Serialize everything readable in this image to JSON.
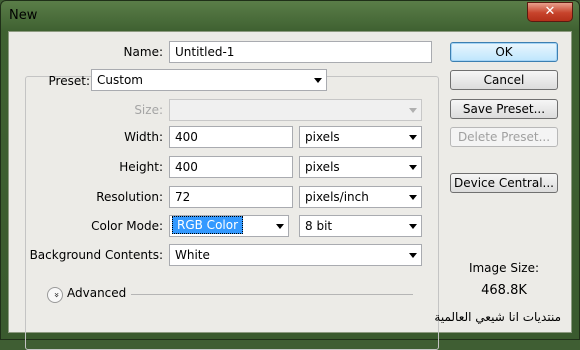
{
  "window": {
    "title": "New",
    "close_glyph": "✕"
  },
  "form": {
    "name_label": "Name:",
    "name_value": "Untitled-1",
    "preset_label": "Preset:",
    "preset_value": "Custom",
    "size_label": "Size:",
    "size_value": "",
    "width_label": "Width:",
    "width_value": "400",
    "width_unit": "pixels",
    "height_label": "Height:",
    "height_value": "400",
    "height_unit": "pixels",
    "resolution_label": "Resolution:",
    "resolution_value": "72",
    "resolution_unit": "pixels/inch",
    "color_mode_label": "Color Mode:",
    "color_mode_value": "RGB Color",
    "bit_depth_value": "8 bit",
    "background_label": "Background Contents:",
    "background_value": "White",
    "advanced_label": "Advanced",
    "advanced_icon": "double-chevron-down-icon",
    "advanced_glyph": "»"
  },
  "buttons": {
    "ok": "OK",
    "cancel": "Cancel",
    "save_preset": "Save Preset...",
    "delete_preset": "Delete Preset...",
    "device_central": "Device Central..."
  },
  "image_size": {
    "label": "Image Size:",
    "value": "468.8K"
  },
  "watermark": "منتديات انا شيعي العالمية",
  "colors": {
    "title_bar": "#3f6131",
    "client_bg": "#ecebe7",
    "selection": "#3399ff",
    "close": "#c7432b"
  }
}
